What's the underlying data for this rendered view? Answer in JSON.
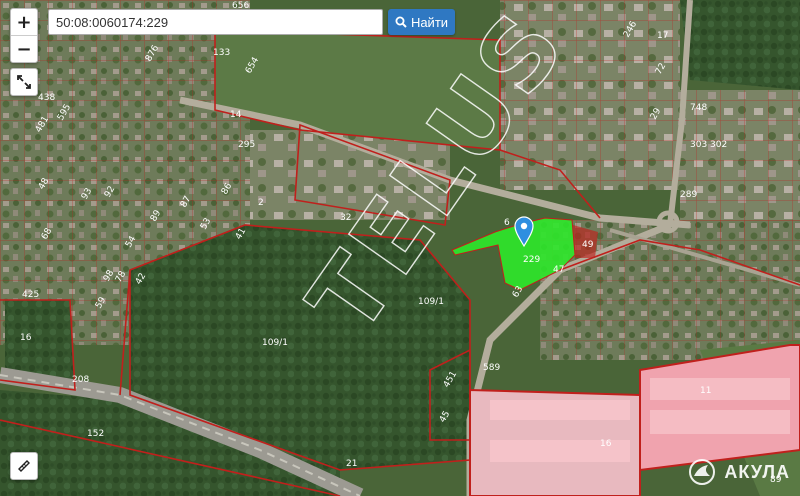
{
  "search": {
    "value": "50:08:0060174:229",
    "placeholder": "",
    "button_label": "Найти"
  },
  "controls": {
    "zoom_in": "+",
    "zoom_out": "−"
  },
  "watermark": "TELUS",
  "logo": {
    "text": "АКУЛА"
  },
  "selected_parcel": {
    "label": "229",
    "highlight_color": "#2ee82a"
  },
  "colors": {
    "boundary": "#c0201c",
    "warehouse": "#f28a98",
    "button": "#2f78c2"
  },
  "labels": [
    {
      "t": "656"
    },
    {
      "t": "133"
    },
    {
      "t": "876"
    },
    {
      "t": "654"
    },
    {
      "t": "438"
    },
    {
      "t": "481"
    },
    {
      "t": "595"
    },
    {
      "t": "14"
    },
    {
      "t": "295"
    },
    {
      "t": "2"
    },
    {
      "t": "32"
    },
    {
      "t": "425"
    },
    {
      "t": "16"
    },
    {
      "t": "208"
    },
    {
      "t": "152"
    },
    {
      "t": "21"
    },
    {
      "t": "109/1"
    },
    {
      "t": "109/1"
    },
    {
      "t": "49"
    },
    {
      "t": "47"
    },
    {
      "t": "6"
    },
    {
      "t": "589"
    },
    {
      "t": "11"
    },
    {
      "t": "16"
    },
    {
      "t": "45"
    },
    {
      "t": "451"
    },
    {
      "t": "289"
    },
    {
      "t": "303"
    },
    {
      "t": "748"
    },
    {
      "t": "89"
    },
    {
      "t": "302"
    },
    {
      "t": "246"
    },
    {
      "t": "17"
    },
    {
      "t": "72"
    },
    {
      "t": "29"
    },
    {
      "t": "48"
    },
    {
      "t": "68"
    },
    {
      "t": "54"
    },
    {
      "t": "78"
    },
    {
      "t": "42"
    },
    {
      "t": "53"
    },
    {
      "t": "98"
    },
    {
      "t": "93"
    },
    {
      "t": "92"
    },
    {
      "t": "87"
    },
    {
      "t": "86"
    },
    {
      "t": "89"
    },
    {
      "t": "41"
    },
    {
      "t": "59"
    },
    {
      "t": "63"
    }
  ]
}
